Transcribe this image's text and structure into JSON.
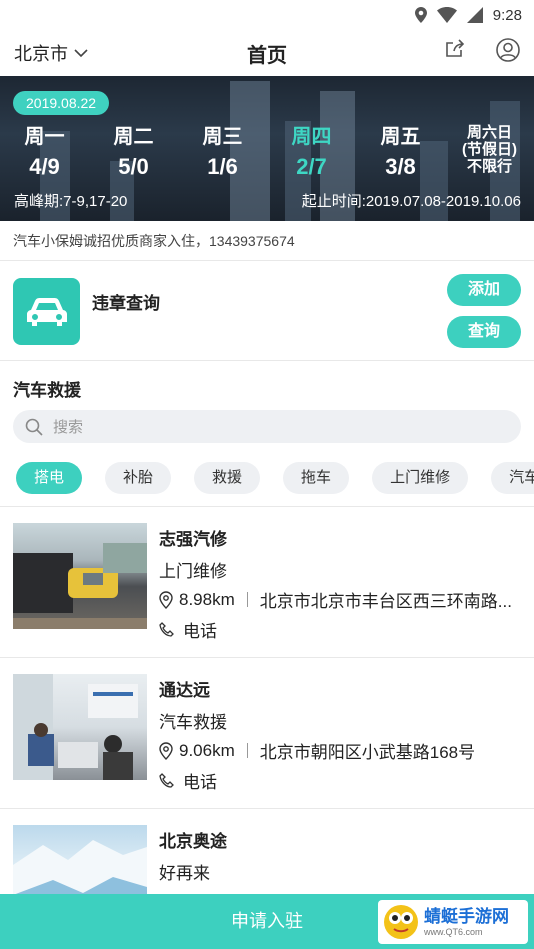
{
  "status_bar": {
    "time": "9:28"
  },
  "navbar": {
    "city": "北京市",
    "title": "首页"
  },
  "banner": {
    "date": "2019.08.22",
    "days": [
      {
        "name": "周一",
        "value": "4/9"
      },
      {
        "name": "周二",
        "value": "5/0"
      },
      {
        "name": "周三",
        "value": "1/6"
      },
      {
        "name": "周四",
        "value": "2/7"
      },
      {
        "name": "周五",
        "value": "3/8"
      }
    ],
    "saturday": {
      "line1": "周六日",
      "line2": "(节假日)",
      "line3": "不限行"
    },
    "peak": "高峰期:7-9,17-20",
    "period": "起止时间:2019.07.08-2019.10.06"
  },
  "notice": "汽车小保姆诚招优质商家入住，13439375674",
  "violation": {
    "title": "违章查询",
    "add_label": "添加",
    "query_label": "查询"
  },
  "rescue": {
    "title": "汽车救援",
    "search_placeholder": "搜索",
    "chips": [
      "搭电",
      "补胎",
      "救援",
      "拖车",
      "上门维修",
      "汽车玻璃"
    ],
    "items": [
      {
        "name": "志强汽修",
        "type": "上门维修",
        "distance": "8.98km",
        "address": "北京市北京市丰台区西三环南路...",
        "phone": "电话"
      },
      {
        "name": "通达远",
        "type": "汽车救援",
        "distance": "9.06km",
        "address": "北京市朝阳区小武基路168号",
        "phone": "电话"
      },
      {
        "name": "北京奥途",
        "type": "好再来"
      }
    ]
  },
  "apply_label": "申请入驻",
  "watermark": {
    "main": "蜻蜓手游网",
    "sub": "www.QT6.com"
  }
}
